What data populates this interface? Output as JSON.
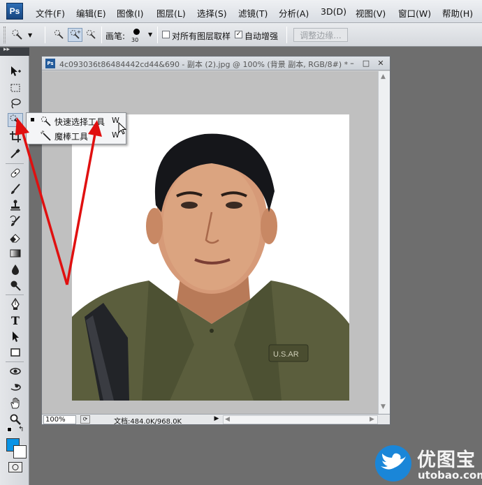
{
  "app": {
    "logo": "Ps"
  },
  "menu": [
    {
      "label": "文件(F)"
    },
    {
      "label": "编辑(E)"
    },
    {
      "label": "图像(I)"
    },
    {
      "label": "图层(L)"
    },
    {
      "label": "选择(S)"
    },
    {
      "label": "滤镜(T)"
    },
    {
      "label": "分析(A)"
    },
    {
      "label": "3D(D)"
    },
    {
      "label": "视图(V)"
    },
    {
      "label": "窗口(W)"
    },
    {
      "label": "帮助(H)"
    }
  ],
  "options": {
    "brush_label": "画笔:",
    "brush_size": "30",
    "sample_all_layers_label": "对所有图层取样",
    "sample_all_layers_checked": false,
    "auto_enhance_label": "自动增强",
    "auto_enhance_checked": true,
    "refine_edge_label": "调整边缘..."
  },
  "tools": [
    {
      "icon": "move-tool-icon"
    },
    {
      "icon": "rectangular-marquee-icon"
    },
    {
      "icon": "lasso-icon"
    },
    {
      "icon": "quick-selection-icon",
      "selected": true
    },
    {
      "icon": "crop-icon"
    },
    {
      "icon": "eyedropper-icon"
    },
    {
      "icon": "healing-brush-icon"
    },
    {
      "icon": "brush-icon"
    },
    {
      "icon": "clone-stamp-icon"
    },
    {
      "icon": "history-brush-icon"
    },
    {
      "icon": "eraser-icon"
    },
    {
      "icon": "gradient-icon"
    },
    {
      "icon": "blur-icon"
    },
    {
      "icon": "dodge-icon"
    },
    {
      "icon": "pen-icon"
    },
    {
      "icon": "type-icon",
      "glyph": "T"
    },
    {
      "icon": "path-selection-icon"
    },
    {
      "icon": "rectangle-shape-icon"
    },
    {
      "icon": "3d-rotate-icon"
    },
    {
      "icon": "3d-orbit-icon"
    },
    {
      "icon": "hand-icon"
    },
    {
      "icon": "zoom-icon"
    }
  ],
  "colors": {
    "foreground": "#0a94e6",
    "background": "#ffffff",
    "annotation_arrow": "#e01010"
  },
  "document": {
    "title": "4c093036t86484442cd44&690 - 副本 (2).jpg @ 100% (背景 副本, RGB/8#) *",
    "zoom": "100%",
    "doc_info": "文档:484.0K/968.0K"
  },
  "flyout": [
    {
      "label": "快速选择工具",
      "shortcut": "W",
      "active": true,
      "icon": "quick-selection-icon"
    },
    {
      "label": "魔棒工具",
      "shortcut": "W",
      "active": false,
      "icon": "magic-wand-icon"
    }
  ],
  "watermark": {
    "cn": "优图宝",
    "en": "utobao.com"
  }
}
